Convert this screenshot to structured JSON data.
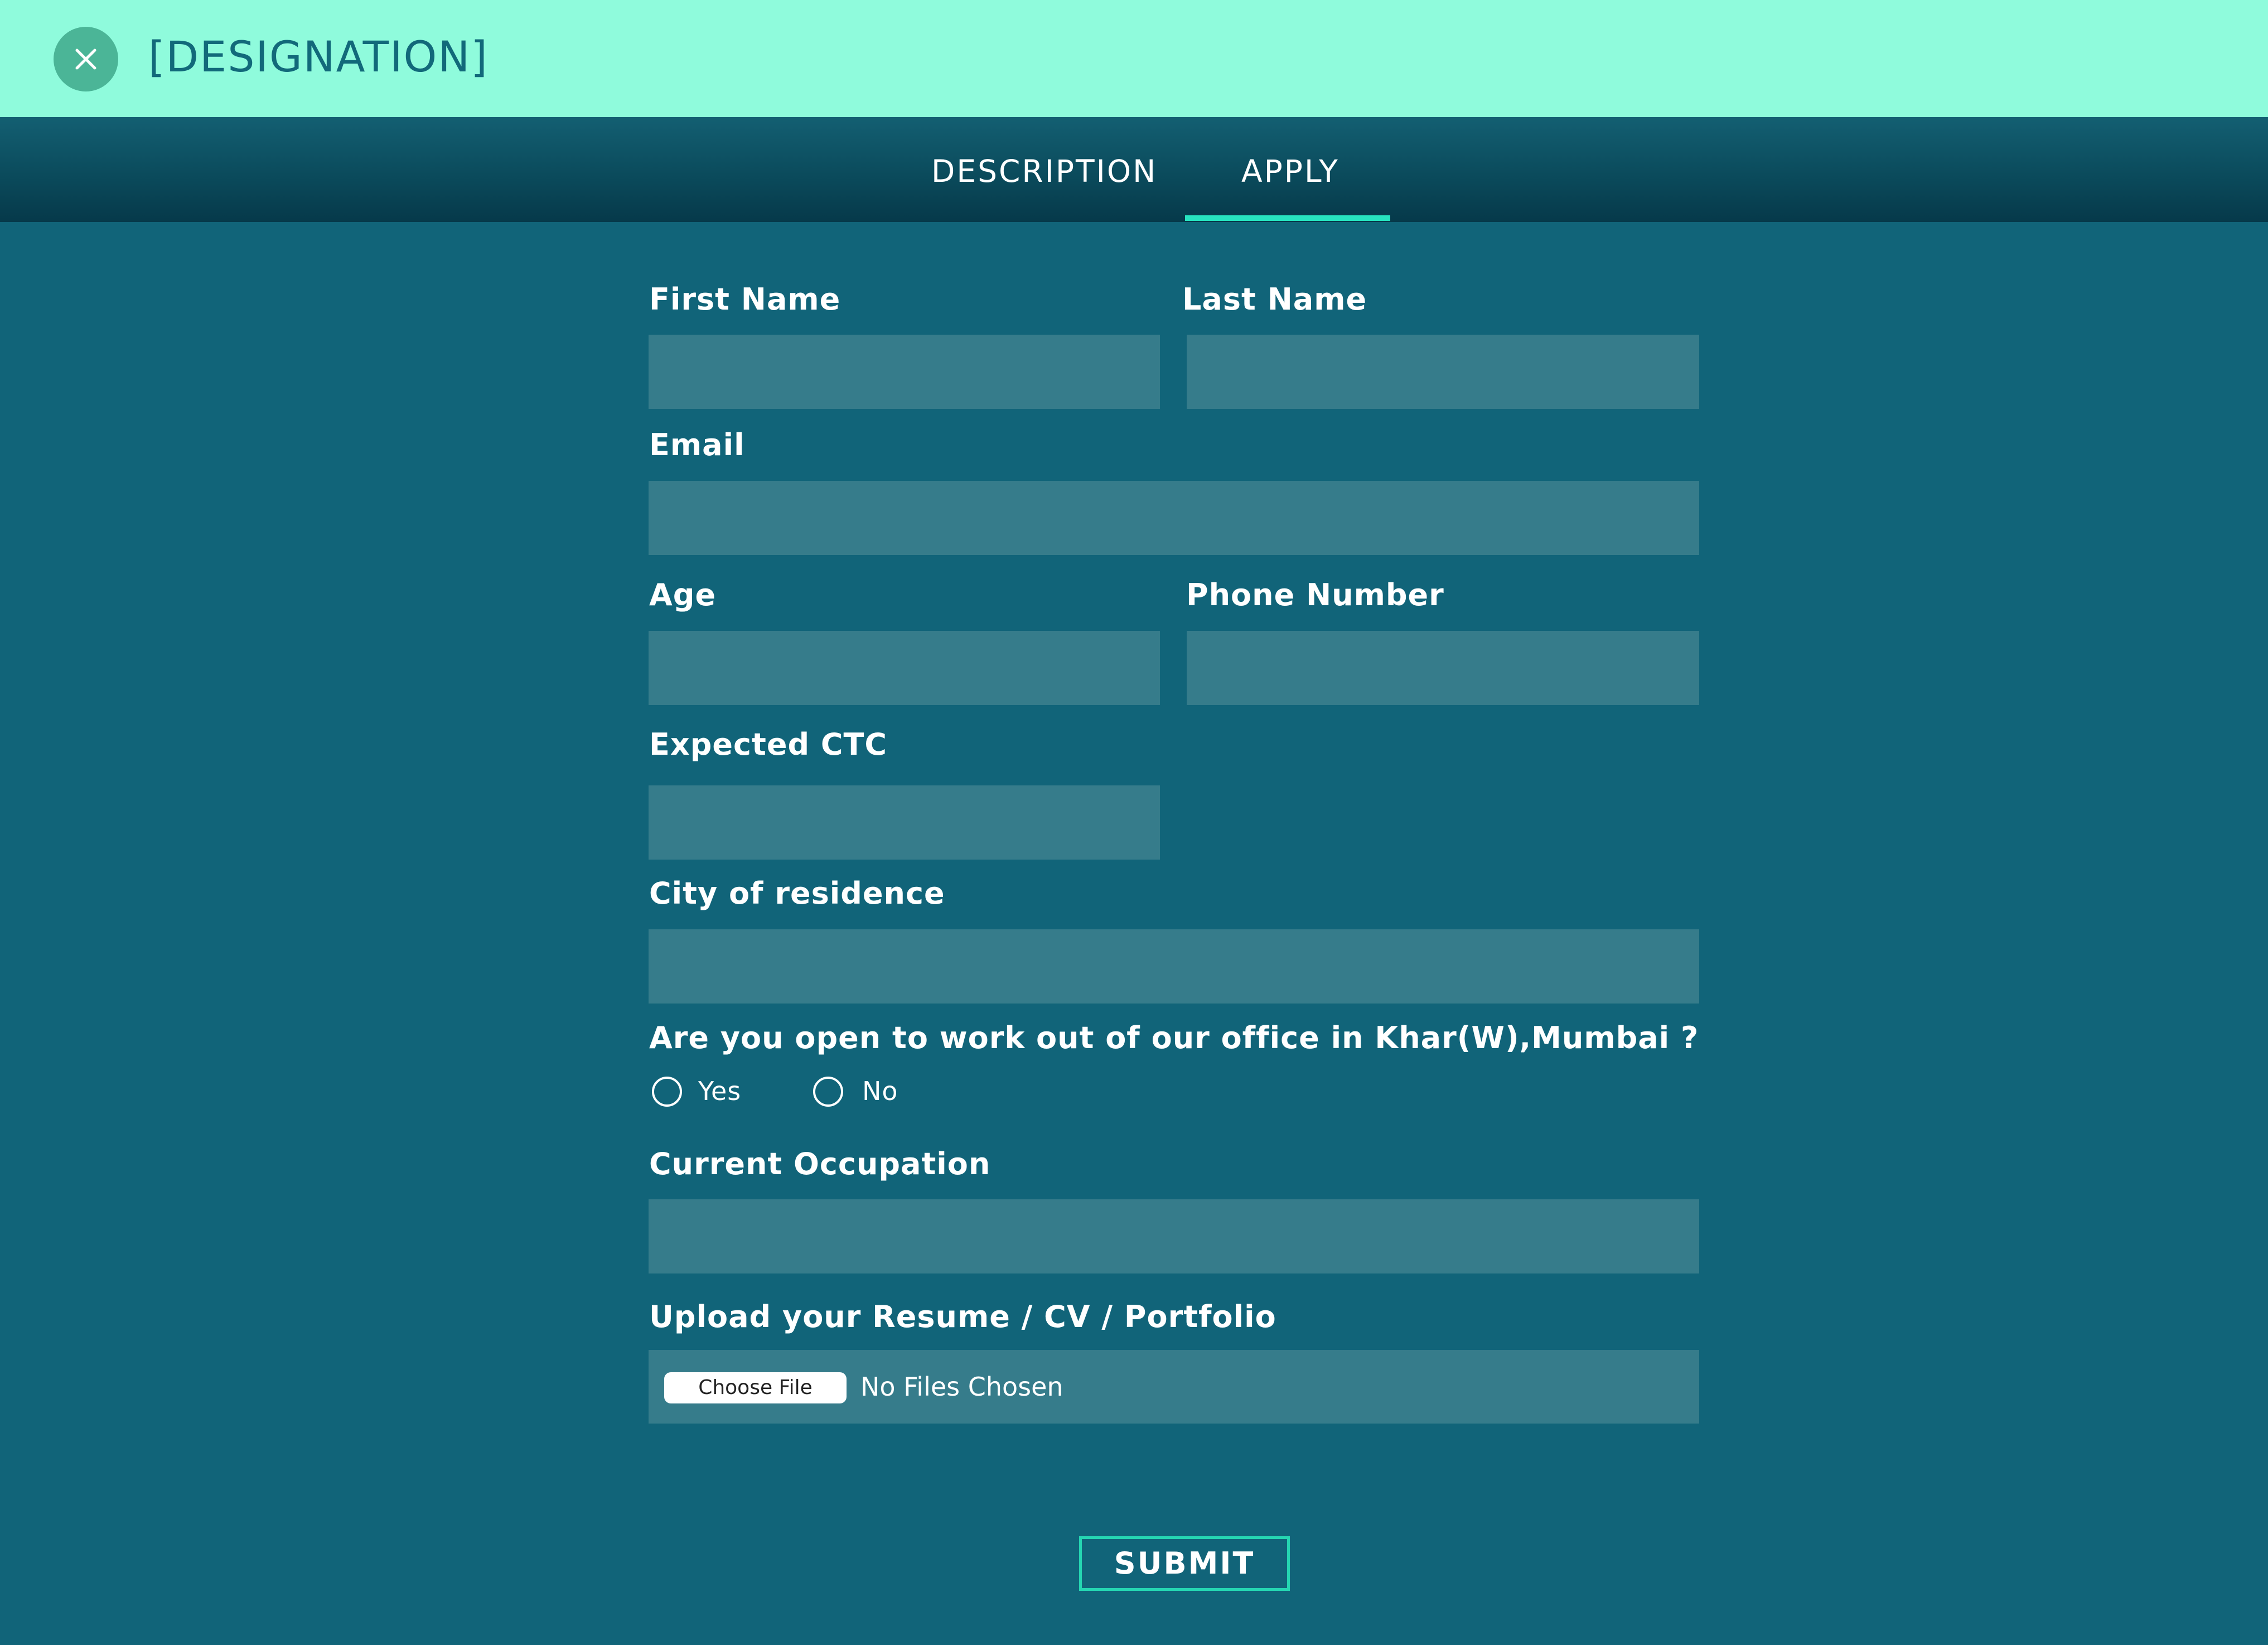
{
  "header": {
    "title": "[DESIGNATION]",
    "close_icon": "close-icon",
    "background_color": "#8ffbdc"
  },
  "tabs": [
    {
      "label": "DESCRIPTION",
      "active": false
    },
    {
      "label": "APPLY",
      "active": true
    }
  ],
  "form": {
    "first_name": {
      "label": "First Name",
      "value": ""
    },
    "last_name": {
      "label": "Last Name",
      "value": ""
    },
    "email": {
      "label": "Email",
      "value": ""
    },
    "age": {
      "label": "Age",
      "value": ""
    },
    "phone": {
      "label": "Phone Number",
      "value": ""
    },
    "expected_ctc": {
      "label": "Expected CTC",
      "value": ""
    },
    "city": {
      "label": "City of residence",
      "value": ""
    },
    "relocate_question": {
      "label": "Are you open to work out of our office in Khar(W),Mumbai ?",
      "options": [
        {
          "label": "Yes",
          "selected": false
        },
        {
          "label": "No",
          "selected": false
        }
      ]
    },
    "occupation": {
      "label": "Current Occupation",
      "value": ""
    },
    "upload": {
      "label": "Upload your Resume / CV / Portfolio",
      "button_label": "Choose File",
      "status": "No Files Chosen"
    },
    "submit_label": "SUBMIT"
  },
  "colors": {
    "page_background": "#116479",
    "field_background": "#367c8b",
    "accent": "#27e3bf"
  }
}
